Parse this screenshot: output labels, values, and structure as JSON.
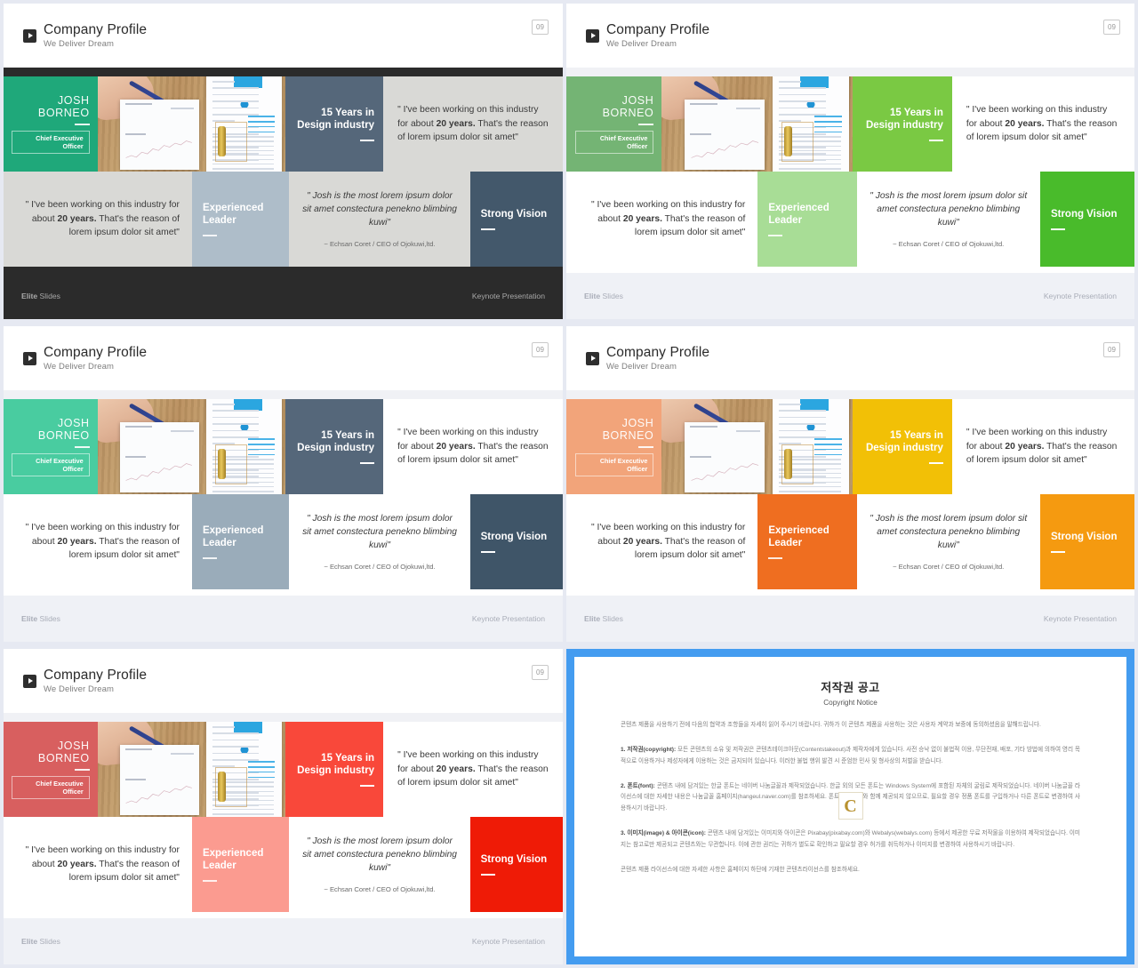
{
  "header": {
    "title": "Company Profile",
    "subtitle": "We Deliver Dream",
    "page_number": "09",
    "play_icon": "play-icon"
  },
  "card": {
    "name_line1": "JOSH",
    "name_line2": "BORNEO",
    "role": "Chief Executive Officer",
    "years_title": "15 Years in Design industry",
    "quote": "\" I've been working on this industry for about 20 years. That's the reason of lorem ipsum dolor sit amet\"",
    "quote_pre": "\" I've been working on this industry for about ",
    "quote_bold": "20 years.",
    "quote_post": " That's the reason of lorem ipsum dolor sit amet\"",
    "experienced_title": "Experienced Leader",
    "testimonial": "\" Josh is the most lorem ipsum dolor sit amet constectura penekno blimbing kuwi\"",
    "testimonial_author": "~ Echsan Coret / CEO of Ojokuwi,ltd.",
    "vision_title": "Strong Vision"
  },
  "footer": {
    "brand_bold": "Elite",
    "brand_rest": " Slides",
    "right": "Keynote Presentation"
  },
  "slides": [
    {
      "id": "slide-dark-green",
      "theme": "dark",
      "bg": "#2b2b2b",
      "strip": "#2b2b2b",
      "name_bg": "#1fa87a",
      "years_bg": "#55677a",
      "quote_bg": "#d9d9d6",
      "quote_text": "#3a3a3a",
      "quote2_bg": "#d9d9d6",
      "exp_bg": "#aebdc9",
      "testi_bg": "#d9d9d6",
      "vision_bg": "#43586b",
      "footer_bg": "#2b2b2b",
      "footer_text": "#a8a8a8"
    },
    {
      "id": "slide-green",
      "theme": "light",
      "bg": "#ffffff",
      "strip": "#f0f1f5",
      "name_bg": "#74b474",
      "years_bg": "#7ac943",
      "quote_bg": "#ffffff",
      "quote_text": "#3a3a3a",
      "quote2_bg": "#ffffff",
      "exp_bg": "#a8dd96",
      "testi_bg": "#ffffff",
      "vision_bg": "#49bb2b",
      "footer_bg": "#eff1f6",
      "footer_text": "#a9adb8"
    },
    {
      "id": "slide-teal",
      "theme": "light",
      "bg": "#ffffff",
      "strip": "#f0f1f5",
      "name_bg": "#49cca0",
      "years_bg": "#55677a",
      "quote_bg": "#ffffff",
      "quote_text": "#3a3a3a",
      "quote2_bg": "#ffffff",
      "exp_bg": "#9aacba",
      "testi_bg": "#ffffff",
      "vision_bg": "#3f5568",
      "footer_bg": "#eff1f6",
      "footer_text": "#a9adb8"
    },
    {
      "id": "slide-orange",
      "theme": "light",
      "bg": "#ffffff",
      "strip": "#f0f1f5",
      "name_bg": "#f2a47a",
      "years_bg": "#f2c006",
      "quote_bg": "#ffffff",
      "quote_text": "#3a3a3a",
      "quote2_bg": "#ffffff",
      "exp_bg": "#ef6e20",
      "testi_bg": "#ffffff",
      "vision_bg": "#f59a10",
      "footer_bg": "#eff1f6",
      "footer_text": "#a9adb8"
    },
    {
      "id": "slide-red",
      "theme": "light",
      "bg": "#ffffff",
      "strip": "#f0f1f5",
      "name_bg": "#d85f5f",
      "years_bg": "#f9483a",
      "quote_bg": "#ffffff",
      "quote_text": "#3a3a3a",
      "quote2_bg": "#ffffff",
      "exp_bg": "#fb9b90",
      "testi_bg": "#ffffff",
      "vision_bg": "#ef1b06",
      "footer_bg": "#eff1f6",
      "footer_text": "#a9adb8"
    }
  ],
  "copyright": {
    "frame_color": "#449cf0",
    "logo_letter": "C",
    "heading_ko": "저작권 공고",
    "heading_en": "Copyright Notice",
    "intro": "콘텐츠 제품을 사용하기 전에 다음의 협약과 조항들을 자세히 읽어 주시기 바랍니다. 귀하가 이 콘텐츠 제품을 사용하는 것은 사용자 계약과 보증에 동의하셨음을 말해드립니다.",
    "p1_label": "1. 저작권(copyright):",
    "p1": " 모든 콘텐츠의 소유 및 저작권은 콘텐츠테이크아웃(Contentstakeout)과 제작자에게 있습니다. 사전 승낙 없이 불법적 이용, 무단전재, 배포, 기타 방법에 의하여 영리 목적으로 이용하거나 제성자에게 이용하는 것은 금지되어 있습니다. 이러한 불법 행위 발견 시 준엄한 민사 및 형사상의 처벌을 받습니다.",
    "p2_label": "2. 폰트(font):",
    "p2": " 콘텐츠 내에 담겨있는 한글 폰트는 네이버 나눔글꼴과 제작되었습니다. 한글 외의 모든 폰트는 Windows System에 포함된 자체의 굴림로 제작되었습니다. 네이버 나눔글꼴 라이선스에 대한 자세한 내용은 나눔글꼴 홈페이지(hangeul.naver.com)를 참조하세요. 폰트는 콘텐츠와 함께 제공되지 않으므로, 필요할 경우 정품 폰트를 구입하거나 다른 폰트로 변경하여 사용하시기 바랍니다.",
    "p3_label": "3. 이미지(image) & 아이콘(icon):",
    "p3": " 콘텐츠 내에 담겨있는 이미지와 아이콘은 Pixabay(pixabay.com)와 Webalys(webalys.com) 등에서 제공한 무료 저작물을 이용하여 제작되었습니다. 이미지는 참고로만 제공되고 콘텐츠와는 무관합니다. 이에 관한 권리는 귀하가 별도로 확인하고 필요할 경우 허가를 취득하거나 이미지를 변경하여 사용하시기 바랍니다.",
    "outro": "콘텐츠 제품 라이선스에 대한 자세한 사항은 홈페이지 하단에 기재한 콘텐츠라이선스를 참조하세요."
  }
}
